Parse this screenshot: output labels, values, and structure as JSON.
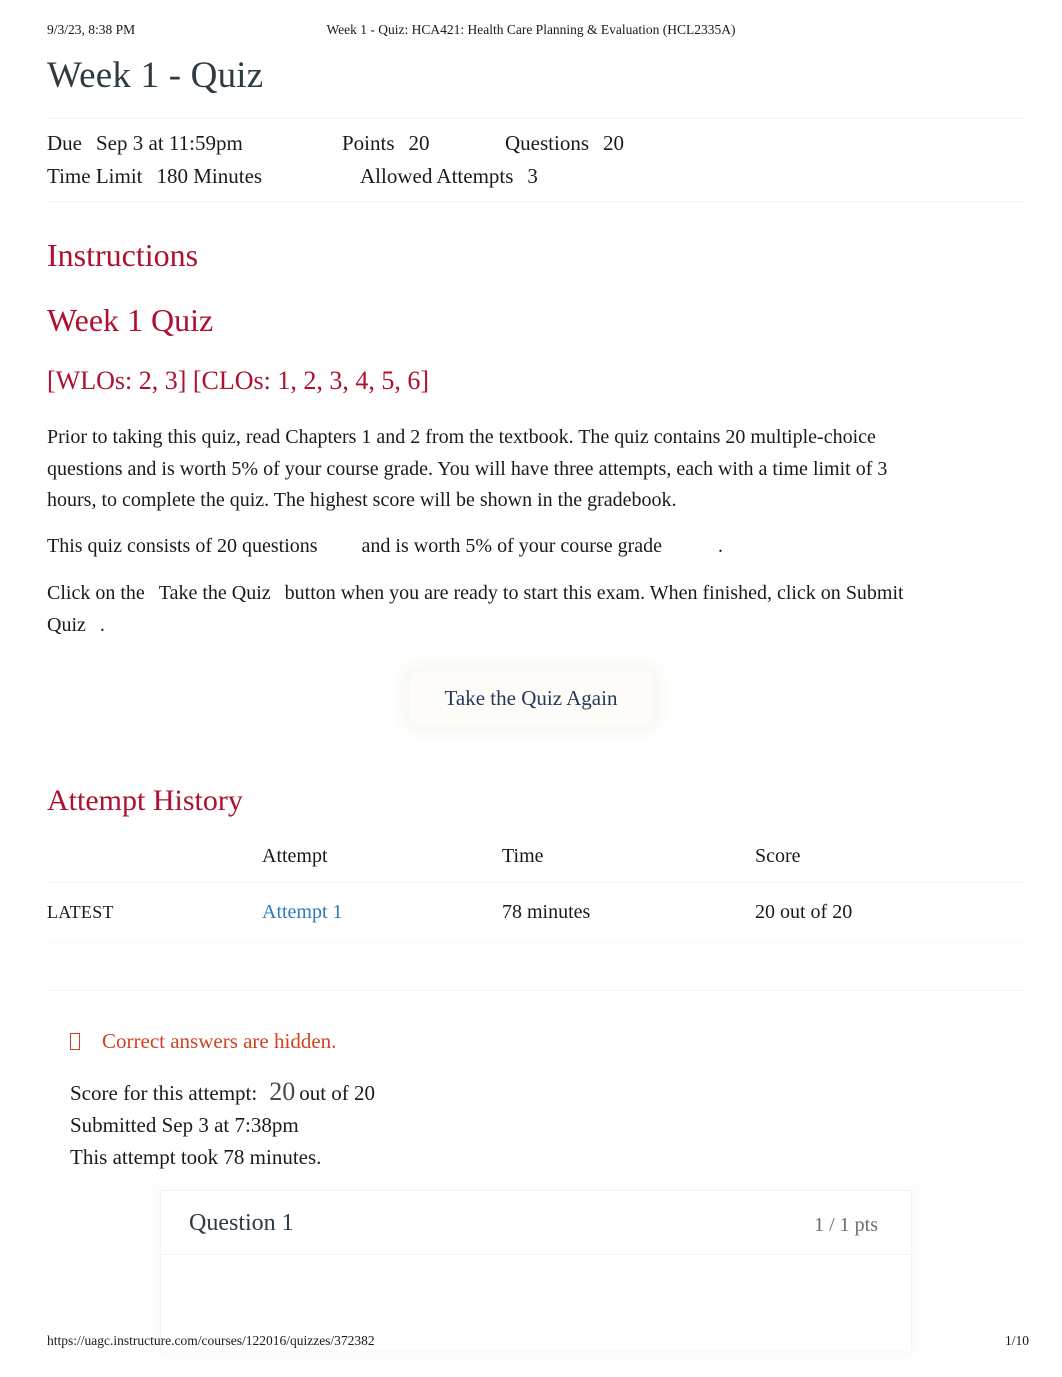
{
  "print_header": {
    "date": "9/3/23, 8:38 PM",
    "title": "Week 1 - Quiz: HCA421: Health Care Planning & Evaluation (HCL2335A)"
  },
  "page_title": "Week 1 - Quiz",
  "quiz_meta": {
    "due_label": "Due",
    "due_value": "Sep 3 at 11:59pm",
    "points_label": "Points",
    "points_value": "20",
    "questions_label": "Questions",
    "questions_value": "20",
    "time_limit_label": "Time Limit",
    "time_limit_value": "180 Minutes",
    "allowed_attempts_label": "Allowed Attempts",
    "allowed_attempts_value": "3"
  },
  "headings": {
    "instructions": "Instructions",
    "week_quiz": "Week 1 Quiz",
    "outcomes": "[WLOs: 2, 3] [CLOs: 1, 2, 3, 4, 5, 6]",
    "attempt_history": "Attempt History"
  },
  "paragraphs": {
    "p1": "Prior to taking this quiz, read Chapters 1 and 2 from the textbook. The quiz contains 20 multiple-choice questions and is worth 5% of your course grade. You will have three attempts, each with a time limit of 3 hours, to complete the quiz. The highest score will be shown in the gradebook.",
    "p2_a": "This quiz consists of 20 questions",
    "p2_b": "and is worth 5% of your course grade",
    "p2_c": ".",
    "p3_a": "Click on the",
    "p3_b": "Take the Quiz",
    "p3_c": "button when you are ready to start this exam. When finished, click on",
    "p3_d": "Submit Quiz",
    "p3_e": "."
  },
  "take_quiz_button": {
    "label": "Take the Quiz Again"
  },
  "attempt_table": {
    "columns": [
      "",
      "Attempt",
      "Time",
      "Score"
    ],
    "rows": [
      {
        "kept": "LATEST",
        "attempt": "Attempt 1",
        "time": "78 minutes",
        "score": "20 out of 20"
      }
    ]
  },
  "answers_hidden_notice": {
    "icon": "missing-glyph-box",
    "text": "Correct answers are hidden."
  },
  "score_summary": {
    "score_label": "Score for this attempt:",
    "score_value": "20",
    "score_out_of": "out of 20",
    "submitted": "Submitted Sep 3 at 7:38pm",
    "duration": "This attempt took 78 minutes."
  },
  "question": {
    "title": "Question 1",
    "points": "1 / 1 pts"
  },
  "print_footer": {
    "url": "https://uagc.instructure.com/courses/122016/quizzes/372382",
    "page": "1/10"
  },
  "colors": {
    "heading_red": "#b01030",
    "link_blue": "#2b7bb9",
    "notice_orange": "#d04221",
    "button_text_navy": "#25395b"
  }
}
